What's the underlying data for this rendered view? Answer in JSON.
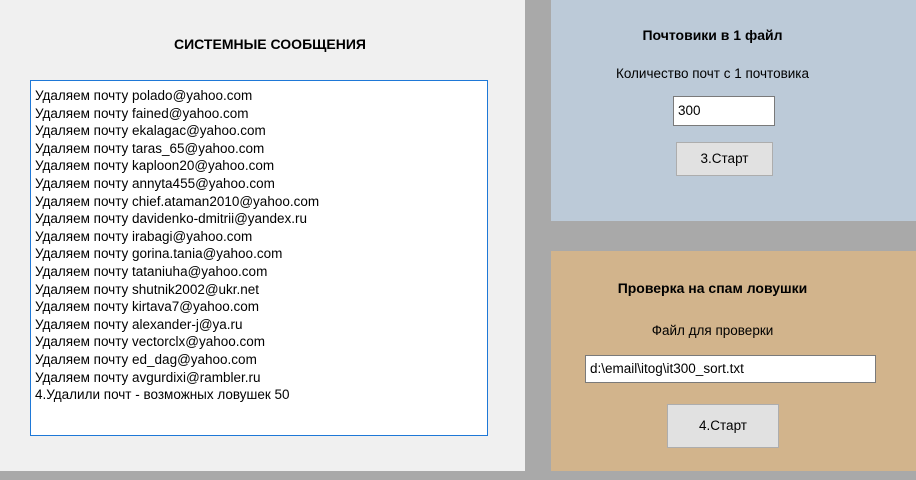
{
  "system_panel": {
    "title": "СИСТЕМНЫЕ СООБЩЕНИЯ",
    "log_lines": [
      "Удаляем почту polado@yahoo.com",
      "Удаляем почту fained@yahoo.com",
      "Удаляем почту ekalagac@yahoo.com",
      "Удаляем почту taras_65@yahoo.com",
      "Удаляем почту kaploon20@yahoo.com",
      "Удаляем почту annyta455@yahoo.com",
      "Удаляем почту chief.ataman2010@yahoo.com",
      "Удаляем почту davidenko-dmitrii@yandex.ru",
      "Удаляем почту irabagi@yahoo.com",
      "Удаляем почту gorina.tania@yahoo.com",
      "Удаляем почту tataniuha@yahoo.com",
      "Удаляем почту shutnik2002@ukr.net",
      "Удаляем почту kirtava7@yahoo.com",
      "Удаляем почту alexander-j@ya.ru",
      "Удаляем почту vectorclx@yahoo.com",
      "Удаляем почту ed_dag@yahoo.com",
      "Удаляем почту avgurdixi@rambler.ru",
      "4.Удалили почт - возможных ловушек 50"
    ]
  },
  "mailers_panel": {
    "title": "Почтовики в 1 файл",
    "label": "Количество почт с 1 почтовика",
    "count_value": "300",
    "start_label": "3.Старт"
  },
  "spam_panel": {
    "title": "Проверка на спам ловушки",
    "label": "Файл для проверки",
    "file_value": "d:\\email\\itog\\it300_sort.txt",
    "start_label": "4.Старт"
  },
  "colors": {
    "window_background": "#a9a9a9",
    "system_panel": "#f0f0f0",
    "mailers_panel": "#bccad8",
    "spam_panel": "#d2b48c",
    "log_border_focus": "#1e78d7"
  }
}
